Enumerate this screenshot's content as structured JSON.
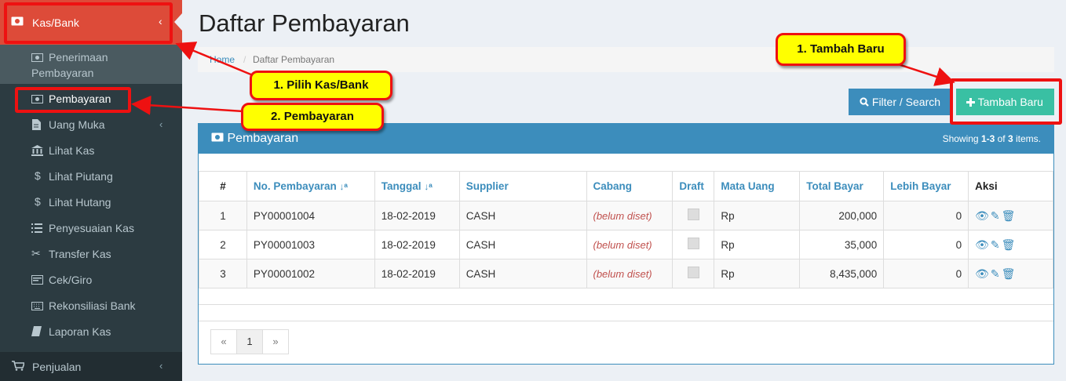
{
  "sidebar": {
    "active": {
      "label": "Kas/Bank"
    },
    "items": [
      {
        "label": "Penerimaan\nPembayaran",
        "line1": "Penerimaan",
        "line2": "Pembayaran"
      },
      {
        "label": "Pembayaran"
      },
      {
        "label": "Uang Muka"
      },
      {
        "label": "Lihat Kas"
      },
      {
        "label": "Lihat Piutang"
      },
      {
        "label": "Lihat Hutang"
      },
      {
        "label": "Penyesuaian Kas"
      },
      {
        "label": "Transfer Kas"
      },
      {
        "label": "Cek/Giro"
      },
      {
        "label": "Rekonsiliasi Bank"
      },
      {
        "label": "Laporan Kas"
      }
    ],
    "penjualan": {
      "label": "Penjualan"
    }
  },
  "page": {
    "title": "Daftar Pembayaran"
  },
  "breadcrumb": {
    "home": "Home",
    "separator": "/",
    "current": "Daftar Pembayaran"
  },
  "toolbar": {
    "filter_label": "Filter / Search",
    "add_label": "Tambah Baru"
  },
  "box": {
    "title": "Pembayaran",
    "summary_prefix": "Showing ",
    "summary_range": "1-3",
    "summary_mid": " of ",
    "summary_total": "3",
    "summary_suffix": " items."
  },
  "table": {
    "headers": [
      "#",
      "No. Pembayaran",
      "Tanggal",
      "Supplier",
      "Cabang",
      "Draft",
      "Mata Uang",
      "Total Bayar",
      "Lebih Bayar",
      "Aksi"
    ],
    "rows": [
      {
        "no": "1",
        "number": "PY00001004",
        "date": "18-02-2019",
        "supplier": "CASH",
        "branch": "(belum diset)",
        "currency": "Rp",
        "total": "200,000",
        "over": "0"
      },
      {
        "no": "2",
        "number": "PY00001003",
        "date": "18-02-2019",
        "supplier": "CASH",
        "branch": "(belum diset)",
        "currency": "Rp",
        "total": "35,000",
        "over": "0"
      },
      {
        "no": "3",
        "number": "PY00001002",
        "date": "18-02-2019",
        "supplier": "CASH",
        "branch": "(belum diset)",
        "currency": "Rp",
        "total": "8,435,000",
        "over": "0"
      }
    ]
  },
  "pagination": {
    "prev": "«",
    "page": "1",
    "next": "»"
  },
  "callouts": {
    "step1": "1. Pilih Kas/Bank",
    "step2": "2. Pembayaran",
    "step_add": "1. Tambah Baru"
  },
  "colors": {
    "sidebar_bg": "#222d32",
    "active": "#dd4b39",
    "primary": "#3c8dbc",
    "success": "#39c0a3",
    "callout": "#ffff00",
    "annotation": "#ee1111"
  }
}
